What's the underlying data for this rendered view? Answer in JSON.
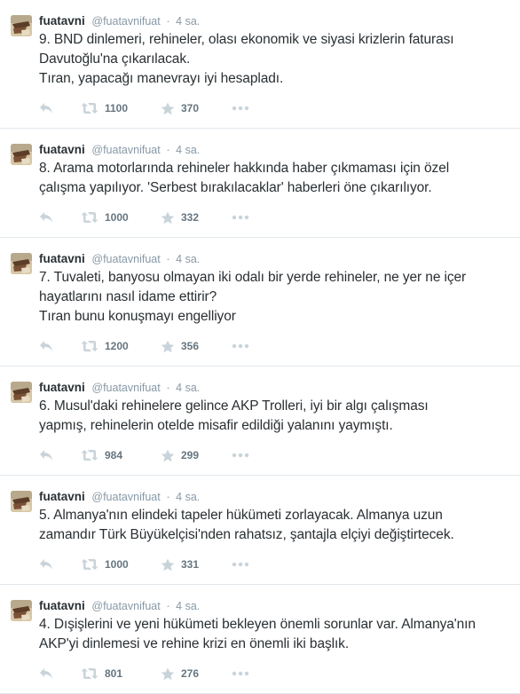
{
  "colors": {
    "muted": "#8899a6",
    "text": "#292f33",
    "divider": "#e1e8ed"
  },
  "tweets": [
    {
      "fullname": "fuatavni",
      "username": "@fuatavnifuat",
      "dot": "·",
      "time": "4 sa.",
      "lines": [
        "9. BND dinlemeri, rehineler, olası ekonomik ve siyasi krizlerin faturası",
        "Davutoğlu'na çıkarılacak.",
        "Tıran, yapacağı manevrayı iyi hesapladı."
      ],
      "retweets": "1100",
      "favorites": "370"
    },
    {
      "fullname": "fuatavni",
      "username": "@fuatavnifuat",
      "dot": "·",
      "time": "4 sa.",
      "lines": [
        "8. Arama motorlarında rehineler hakkında haber çıkmaması için özel",
        "çalışma yapılıyor. 'Serbest bırakılacaklar' haberleri öne çıkarılıyor."
      ],
      "retweets": "1000",
      "favorites": "332"
    },
    {
      "fullname": "fuatavni",
      "username": "@fuatavnifuat",
      "dot": "·",
      "time": "4 sa.",
      "lines": [
        "7. Tuvaleti, banyosu olmayan iki odalı bir yerde rehineler, ne yer ne içer",
        "hayatlarını nasıl idame ettirir?",
        "Tıran bunu konuşmayı engelliyor"
      ],
      "retweets": "1200",
      "favorites": "356"
    },
    {
      "fullname": "fuatavni",
      "username": "@fuatavnifuat",
      "dot": "·",
      "time": "4 sa.",
      "lines": [
        "6. Musul'daki rehinelere gelince AKP Trolleri, iyi bir algı çalışması",
        "yapmış, rehinelerin otelde misafir edildiği yalanını yaymıştı."
      ],
      "retweets": "984",
      "favorites": "299"
    },
    {
      "fullname": "fuatavni",
      "username": "@fuatavnifuat",
      "dot": "·",
      "time": "4 sa.",
      "lines": [
        "5. Almanya'nın elindeki tapeler hükümeti zorlayacak. Almanya uzun",
        "zamandır Türk Büyükelçisi'nden rahatsız, şantajla elçiyi değiştirtecek."
      ],
      "retweets": "1000",
      "favorites": "331"
    },
    {
      "fullname": "fuatavni",
      "username": "@fuatavnifuat",
      "dot": "·",
      "time": "4 sa.",
      "lines": [
        "4. Dışişlerini ve yeni hükümeti bekleyen önemli sorunlar var. Almanya'nın",
        "AKP'yi dinlemesi ve rehine krizi en önemli iki başlık."
      ],
      "retweets": "801",
      "favorites": "276"
    }
  ]
}
